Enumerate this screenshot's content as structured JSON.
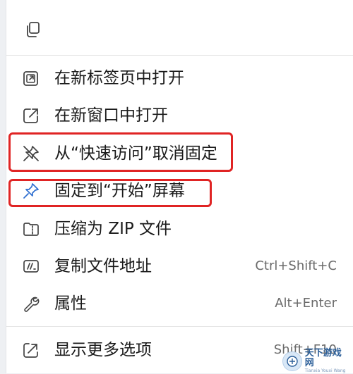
{
  "menu": {
    "items": [
      {
        "label": "在新标签页中打开",
        "icon": "open-in-new-tab-icon",
        "shortcut": ""
      },
      {
        "label": "在新窗口中打开",
        "icon": "open-in-new-window-icon",
        "shortcut": ""
      },
      {
        "label": "从“快速访问”取消固定",
        "icon": "unpin-icon",
        "shortcut": ""
      },
      {
        "label": "固定到“开始”屏幕",
        "icon": "pin-icon",
        "shortcut": ""
      },
      {
        "label": "压缩为 ZIP 文件",
        "icon": "zip-folder-icon",
        "shortcut": ""
      },
      {
        "label": "复制文件地址",
        "icon": "copy-path-icon",
        "shortcut": "Ctrl+Shift+C"
      },
      {
        "label": "属性",
        "icon": "wrench-icon",
        "shortcut": "Alt+Enter"
      },
      {
        "label": "显示更多选项",
        "icon": "show-more-options-icon",
        "shortcut": "Shift+F10"
      }
    ]
  },
  "toolbar": {
    "copy_icon": "copy-icon"
  },
  "watermark": {
    "name": "天下游戏网",
    "sub": "Tianxia Youxi Wang"
  },
  "colors": {
    "highlight": "#e02424",
    "text": "#1b1b1b",
    "shortcut": "#6a6a6a"
  }
}
